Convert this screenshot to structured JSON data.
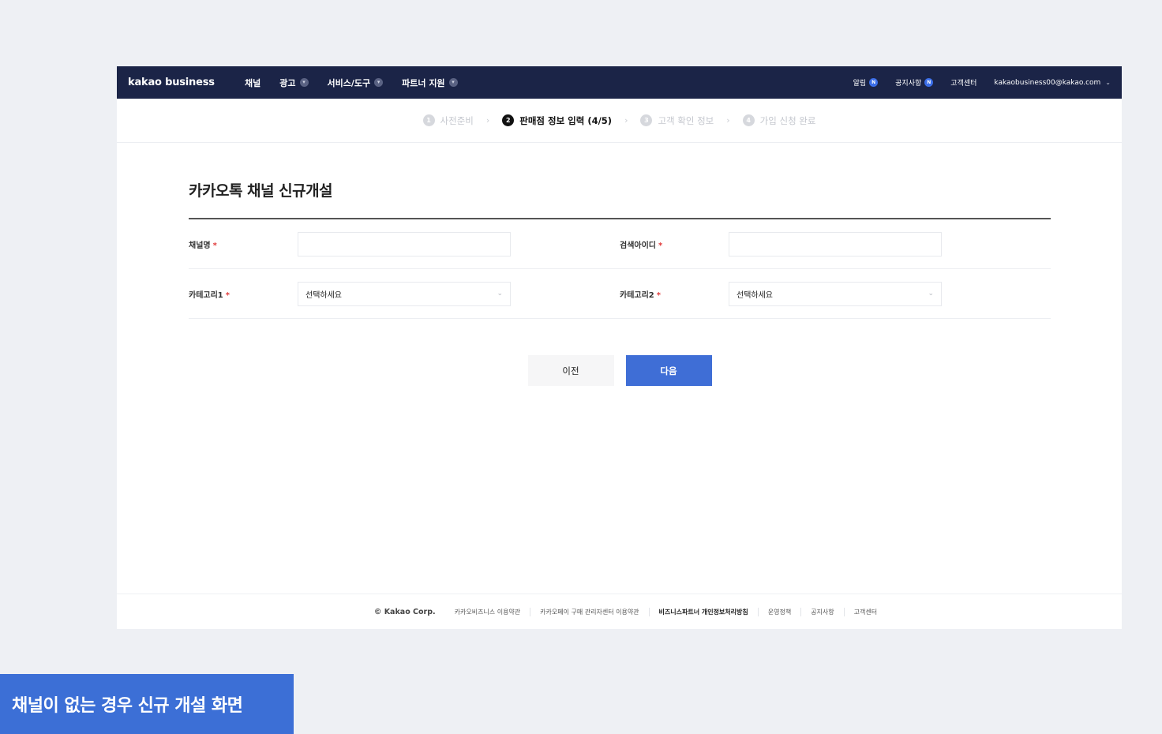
{
  "topbar": {
    "brand": "kakao business",
    "nav": [
      {
        "label": "채널",
        "caret": false
      },
      {
        "label": "광고",
        "caret": true
      },
      {
        "label": "서비스/도구",
        "caret": true
      },
      {
        "label": "파트너 지원",
        "caret": true
      }
    ],
    "right": {
      "notice_label": "알림",
      "notice_badge": "N",
      "announcement_label": "공지사항",
      "announcement_badge": "N",
      "support_label": "고객센터",
      "account_email": "kakaobusiness00@kakao.com"
    }
  },
  "stepper": {
    "steps": [
      {
        "num": "1",
        "label": "사전준비"
      },
      {
        "num": "2",
        "label": "판매점 정보 입력 (4/5)"
      },
      {
        "num": "3",
        "label": "고객 확인 정보"
      },
      {
        "num": "4",
        "label": "가입 신청 완료"
      }
    ],
    "active_index": 1
  },
  "form": {
    "title": "카카오톡 채널 신규개설",
    "required_mark": "*",
    "channel_name_label": "채널명",
    "channel_name_value": "",
    "search_id_label": "검색아이디",
    "search_id_value": "",
    "category1_label": "카테고리1",
    "category1_value": "선택하세요",
    "category2_label": "카테고리2",
    "category2_value": "선택하세요"
  },
  "buttons": {
    "prev": "이전",
    "next": "다음"
  },
  "footer": {
    "copyright": "© Kakao Corp.",
    "links": [
      {
        "label": "카카오비즈니스 이용약관",
        "bold": false
      },
      {
        "label": "카카오페이 구매 관리자센터 이용약관",
        "bold": false
      },
      {
        "label": "비즈니스파트너 개인정보처리방침",
        "bold": true
      },
      {
        "label": "운영정책",
        "bold": false
      },
      {
        "label": "공지사항",
        "bold": false
      },
      {
        "label": "고객센터",
        "bold": false
      }
    ]
  },
  "caption": "채널이 없는 경우 신규 개설 화면",
  "colors": {
    "topbar_bg": "#1b2447",
    "primary_button": "#3f6ed6",
    "caption_bg": "#3c6fd6",
    "badge": "#3b6ee8",
    "required": "#e03b3b"
  }
}
